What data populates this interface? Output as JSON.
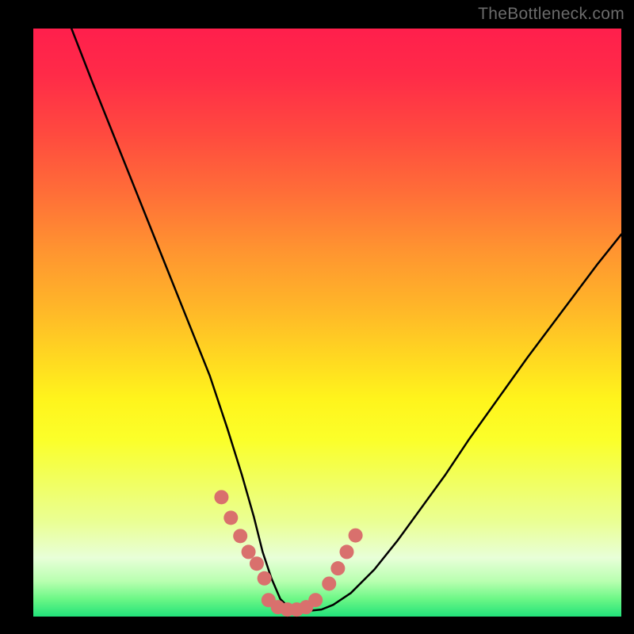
{
  "watermark": "TheBottleneck.com",
  "chart_data": {
    "type": "line",
    "title": "",
    "xlabel": "",
    "ylabel": "",
    "xlim": [
      0,
      100
    ],
    "ylim": [
      0,
      100
    ],
    "series": [
      {
        "name": "bottleneck-curve",
        "x": [
          6.5,
          10,
          14,
          18,
          22,
          26,
          30,
          33,
          35.5,
          37.5,
          39,
          40.5,
          42,
          43.5,
          45,
          47,
          49,
          51,
          54,
          58,
          62,
          66,
          70,
          74,
          79,
          84,
          90,
          96,
          100
        ],
        "y": [
          100,
          91,
          81,
          71,
          61,
          51,
          41,
          32,
          24,
          17,
          11,
          6.5,
          3,
          1.5,
          1,
          1,
          1.2,
          2,
          4,
          8,
          13,
          18.5,
          24,
          30,
          37,
          44,
          52,
          60,
          65
        ]
      },
      {
        "name": "highlight-dots-left",
        "x": [
          32.0,
          33.6,
          35.2,
          36.6,
          38.0,
          39.3
        ],
        "y": [
          20.3,
          16.8,
          13.7,
          11.0,
          9.0,
          6.5
        ]
      },
      {
        "name": "highlight-dots-bottom",
        "x": [
          40.0,
          41.6,
          43.2,
          44.8,
          46.4,
          48.0
        ],
        "y": [
          2.8,
          1.6,
          1.2,
          1.2,
          1.6,
          2.8
        ]
      },
      {
        "name": "highlight-dots-right",
        "x": [
          50.3,
          51.8,
          53.3,
          54.8
        ],
        "y": [
          5.6,
          8.2,
          11.0,
          13.8
        ]
      }
    ],
    "colors": {
      "curve": "#000000",
      "highlight": "#d9706d",
      "gradient_top": "#ff1f4c",
      "gradient_mid": "#ffe421",
      "gradient_bottom": "#22e27a"
    }
  }
}
